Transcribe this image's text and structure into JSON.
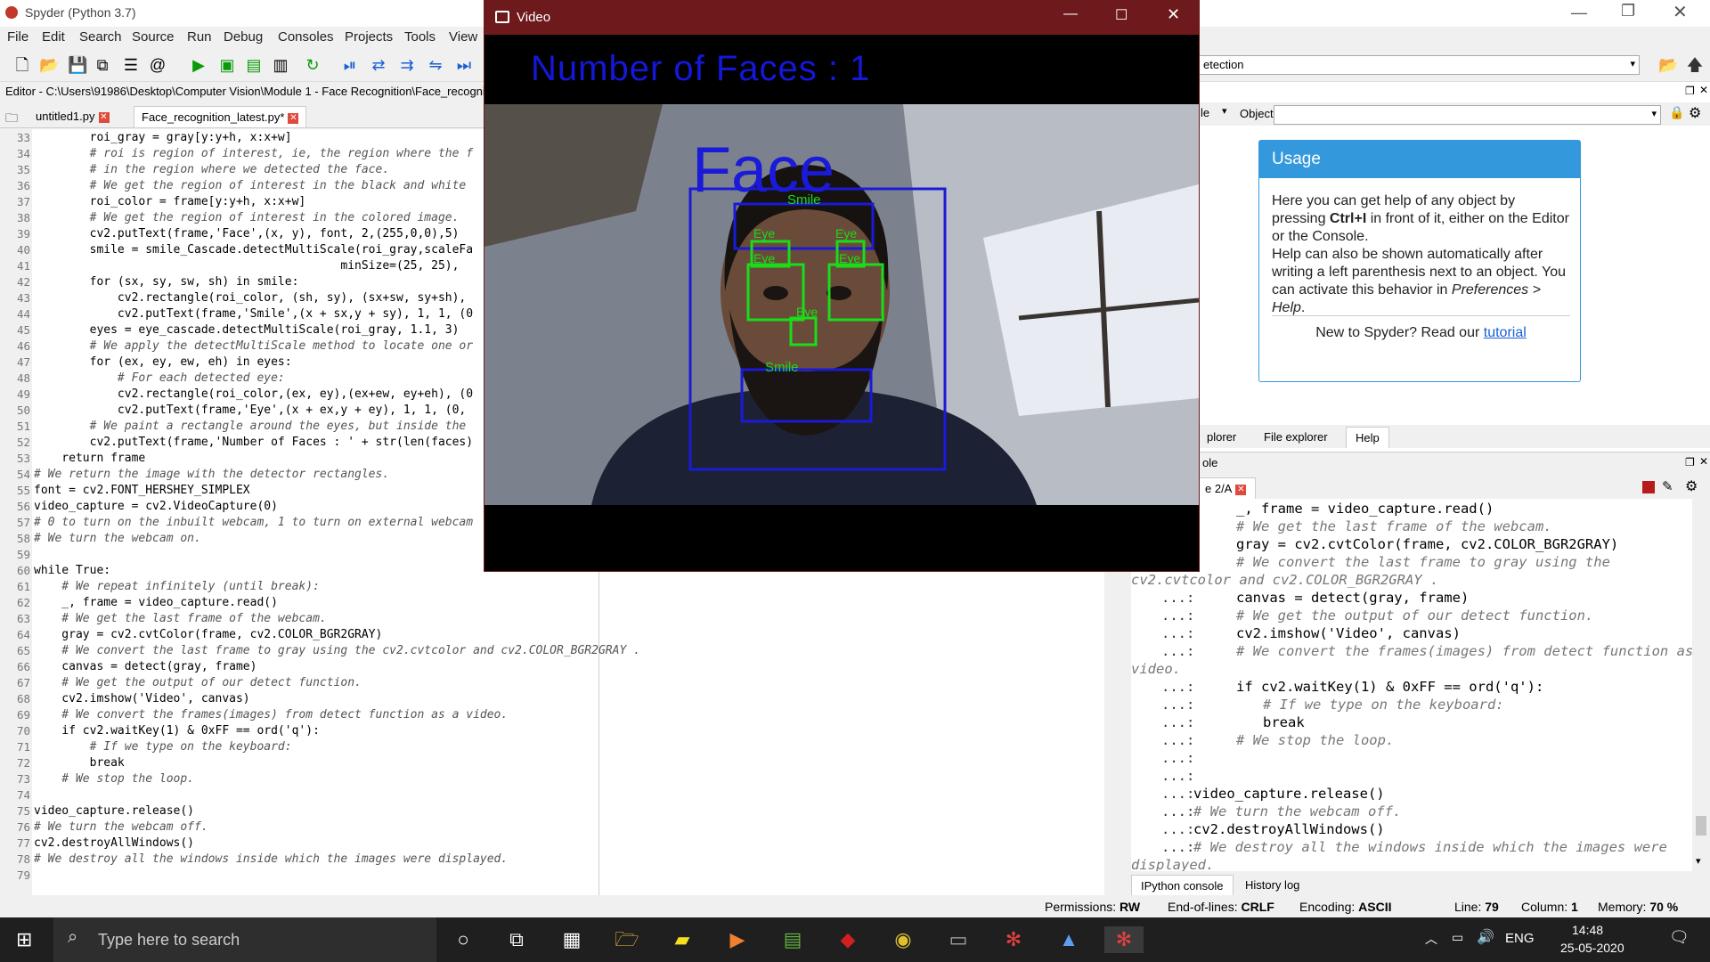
{
  "spyder": {
    "title": "Spyder (Python 3.7)",
    "menus": [
      "File",
      "Edit",
      "Search",
      "Source",
      "Run",
      "Debug",
      "Consoles",
      "Projects",
      "Tools",
      "View"
    ],
    "editor_path": "Editor - C:\\Users\\91986\\Desktop\\Computer Vision\\Module 1 - Face Recognition\\Face_recognit",
    "tabs": [
      "untitled1.py",
      "Face_recognition_latest.py*"
    ],
    "file_search_value": "etection",
    "object_label": "Object",
    "object_left_label": "le"
  },
  "editor_lines": [
    {
      "n": "33",
      "t": "        roi_gray = gray[y:y+h, x:x+w]",
      "c": false
    },
    {
      "n": "34",
      "t": "        # roi is region of interest, ie, the region where the f",
      "c": true
    },
    {
      "n": "35",
      "t": "        # in the region where we detected the face.",
      "c": true
    },
    {
      "n": "36",
      "t": "        # We get the region of interest in the black and white",
      "c": true
    },
    {
      "n": "37",
      "t": "        roi_color = frame[y:y+h, x:x+w]",
      "c": false
    },
    {
      "n": "38",
      "t": "        # We get the region of interest in the colored image.",
      "c": true
    },
    {
      "n": "39",
      "t": "        cv2.putText(frame,'Face',(x, y), font, 2,(255,0,0),5)",
      "c": false
    },
    {
      "n": "40",
      "t": "        smile = smile_Cascade.detectMultiScale(roi_gray,scaleFa",
      "c": false
    },
    {
      "n": "41",
      "t": "                                            minSize=(25, 25),",
      "c": false
    },
    {
      "n": "42",
      "t": "        for (sx, sy, sw, sh) in smile:",
      "c": false
    },
    {
      "n": "43",
      "t": "            cv2.rectangle(roi_color, (sh, sy), (sx+sw, sy+sh),",
      "c": false
    },
    {
      "n": "44",
      "t": "            cv2.putText(frame,'Smile',(x + sx,y + sy), 1, 1, (0",
      "c": false
    },
    {
      "n": "45",
      "t": "        eyes = eye_cascade.detectMultiScale(roi_gray, 1.1, 3)",
      "c": false
    },
    {
      "n": "46",
      "t": "        # We apply the detectMultiScale method to locate one or",
      "c": true
    },
    {
      "n": "47",
      "t": "        for (ex, ey, ew, eh) in eyes:",
      "c": false
    },
    {
      "n": "48",
      "t": "            # For each detected eye:",
      "c": true
    },
    {
      "n": "49",
      "t": "            cv2.rectangle(roi_color,(ex, ey),(ex+ew, ey+eh), (0",
      "c": false
    },
    {
      "n": "50",
      "t": "            cv2.putText(frame,'Eye',(x + ex,y + ey), 1, 1, (0,",
      "c": false
    },
    {
      "n": "51",
      "t": "        # We paint a rectangle around the eyes, but inside the",
      "c": true
    },
    {
      "n": "52",
      "t": "        cv2.putText(frame,'Number of Faces : ' + str(len(faces)",
      "c": false
    },
    {
      "n": "53",
      "t": "    return frame",
      "c": false
    },
    {
      "n": "54",
      "t": "# We return the image with the detector rectangles.",
      "c": true
    },
    {
      "n": "55",
      "t": "font = cv2.FONT_HERSHEY_SIMPLEX",
      "c": false
    },
    {
      "n": "56",
      "t": "video_capture = cv2.VideoCapture(0)",
      "c": false
    },
    {
      "n": "57",
      "t": "# 0 to turn on the inbuilt webcam, 1 to turn on external webcam",
      "c": true
    },
    {
      "n": "58",
      "t": "# We turn the webcam on.",
      "c": true
    },
    {
      "n": "59",
      "t": "",
      "c": false
    },
    {
      "n": "60",
      "t": "while True:",
      "c": false
    },
    {
      "n": "61",
      "t": "    # We repeat infinitely (until break):",
      "c": true
    },
    {
      "n": "62",
      "t": "    _, frame = video_capture.read()",
      "c": false
    },
    {
      "n": "63",
      "t": "    # We get the last frame of the webcam.",
      "c": true
    },
    {
      "n": "64",
      "t": "    gray = cv2.cvtColor(frame, cv2.COLOR_BGR2GRAY)",
      "c": false
    },
    {
      "n": "65",
      "t": "    # We convert the last frame to gray using the cv2.cvtcolor and cv2.COLOR_BGR2GRAY .",
      "c": true
    },
    {
      "n": "66",
      "t": "    canvas = detect(gray, frame)",
      "c": false
    },
    {
      "n": "67",
      "t": "    # We get the output of our detect function.",
      "c": true
    },
    {
      "n": "68",
      "t": "    cv2.imshow('Video', canvas)",
      "c": false
    },
    {
      "n": "69",
      "t": "    # We convert the frames(images) from detect function as a video.",
      "c": true
    },
    {
      "n": "70",
      "t": "    if cv2.waitKey(1) & 0xFF == ord('q'):",
      "c": false
    },
    {
      "n": "71",
      "t": "        # If we type on the keyboard:",
      "c": true
    },
    {
      "n": "72",
      "t": "        break",
      "c": false
    },
    {
      "n": "73",
      "t": "    # We stop the loop.",
      "c": true
    },
    {
      "n": "74",
      "t": "",
      "c": false
    },
    {
      "n": "75",
      "t": "video_capture.release()",
      "c": false
    },
    {
      "n": "76",
      "t": "# We turn the webcam off.",
      "c": true
    },
    {
      "n": "77",
      "t": "cv2.destroyAllWindows()",
      "c": false
    },
    {
      "n": "78",
      "t": "# We destroy all the windows inside which the images were displayed.",
      "c": true
    },
    {
      "n": "79",
      "t": "",
      "c": false
    }
  ],
  "help": {
    "usage_title": "Usage",
    "p1a": "Here you can get help of any object by pressing ",
    "p1b": "Ctrl+I",
    "p1c": " in front of it, either on the Editor or the Console.",
    "p2a": "Help can also be shown automatically after writing a left parenthesis next to an object. You can activate this behavior in ",
    "p2b": "Preferences > Help",
    "p2c": ".",
    "p3a": "New to Spyder? Read our ",
    "p3b": "tutorial",
    "tabs": [
      "plorer",
      "File explorer",
      "Help"
    ]
  },
  "console": {
    "header": "ole",
    "tab_label": "e 2/A",
    "lines": [
      {
        "p": "",
        "t": "_, frame = video_capture.read()",
        "c": false,
        "ind": 1
      },
      {
        "p": "",
        "t": "# We get the last frame of the webcam.",
        "c": true,
        "ind": 1
      },
      {
        "p": "",
        "t": "gray = cv2.cvtColor(frame, cv2.COLOR_BGR2GRAY)",
        "c": false,
        "ind": 1
      },
      {
        "p": "",
        "t": "# We convert the last frame to gray using the",
        "c": true,
        "ind": 1
      },
      {
        "p": "",
        "t": "cv2.cvtcolor and cv2.COLOR_BGR2GRAY .",
        "c": true,
        "ind": 0
      },
      {
        "p": "...:",
        "t": "canvas = detect(gray, frame)",
        "c": false,
        "ind": 1
      },
      {
        "p": "...:",
        "t": "# We get the output of our detect function.",
        "c": true,
        "ind": 1
      },
      {
        "p": "...:",
        "t": "cv2.imshow('Video', canvas)",
        "c": false,
        "ind": 1
      },
      {
        "p": "...:",
        "t": "# We convert the frames(images) from detect function as a",
        "c": true,
        "ind": 1
      },
      {
        "p": "",
        "t": "video.",
        "c": true,
        "ind": 0
      },
      {
        "p": "...:",
        "t": "if cv2.waitKey(1) & 0xFF == ord('q'):",
        "c": false,
        "ind": 1
      },
      {
        "p": "...:",
        "t": "# If we type on the keyboard:",
        "c": true,
        "ind": 2
      },
      {
        "p": "...:",
        "t": "break",
        "c": false,
        "ind": 2
      },
      {
        "p": "...:",
        "t": "# We stop the loop.",
        "c": true,
        "ind": 1
      },
      {
        "p": "...:",
        "t": "",
        "c": false,
        "ind": 0
      },
      {
        "p": "...:",
        "t": "",
        "c": false,
        "ind": 0
      },
      {
        "p": "...:",
        "t": "video_capture.release()",
        "c": false,
        "ind": 0
      },
      {
        "p": "...:",
        "t": "# We turn the webcam off.",
        "c": true,
        "ind": 0
      },
      {
        "p": "...:",
        "t": "cv2.destroyAllWindows()",
        "c": false,
        "ind": 0
      },
      {
        "p": "...:",
        "t": "# We destroy all the windows inside which the images were",
        "c": true,
        "ind": 0
      },
      {
        "p": "",
        "t": "displayed.",
        "c": true,
        "ind": 0
      }
    ],
    "bottom_tabs": [
      "IPython console",
      "History log"
    ]
  },
  "status": {
    "permissions_label": "Permissions:",
    "permissions": "RW",
    "eol_label": "End-of-lines:",
    "eol": "CRLF",
    "enc_label": "Encoding:",
    "enc": "ASCII",
    "line_label": "Line:",
    "line": "79",
    "col_label": "Column:",
    "col": "1",
    "mem_label": "Memory:",
    "mem": "70 %"
  },
  "video": {
    "title": "Video",
    "faces_text": "Number of Faces : 1",
    "face_label": "Face",
    "smile_label": "Smile",
    "eye_label": "Eye",
    "box_blue": "#1a1ad8",
    "box_green": "#1adc1a"
  },
  "taskbar": {
    "search_placeholder": "Type here to search",
    "lang": "ENG",
    "time": "14:48",
    "date": "25-05-2020"
  }
}
